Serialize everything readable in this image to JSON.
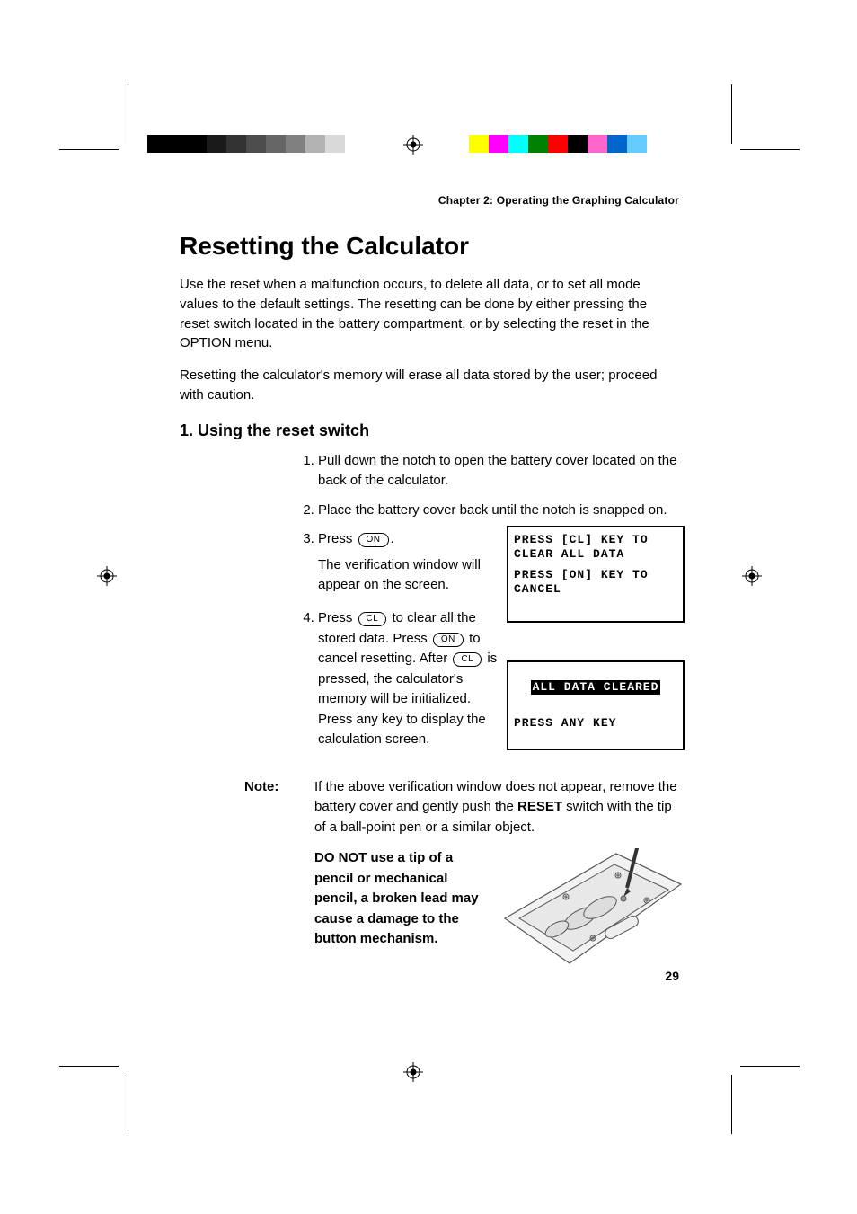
{
  "chapter_header": "Chapter 2: Operating the Graphing Calculator",
  "title": "Resetting the Calculator",
  "intro_p1": "Use the reset when a malfunction occurs, to delete all data, or to set all mode values to the default settings. The resetting can be done by either pressing the reset switch located in the battery compartment, or by selecting the reset in the OPTION menu.",
  "intro_p2": "Resetting the calculator's memory will erase all data stored by the user; proceed with caution.",
  "subsection": "1. Using the reset switch",
  "steps": {
    "s1": "Pull down the notch to open the battery cover located on the back of the calculator.",
    "s2": "Place the battery cover back until the notch is snapped on.",
    "s3a": "Press ",
    "s3_key": "ON",
    "s3b": ".",
    "s3_after": "The verification window will appear on the screen.",
    "s4a": "Press ",
    "s4_key1": "CL",
    "s4b": " to clear all the stored data. Press ",
    "s4_key2": "ON",
    "s4c": " to cancel resetting. After ",
    "s4_key3": "CL",
    "s4d": " is pressed, the calculator's memory will be initialized. Press any key to display the calculation screen."
  },
  "lcd1": {
    "l1": "PRESS [CL] KEY TO",
    "l2": "CLEAR ALL DATA",
    "l3": "PRESS [ON] KEY TO",
    "l4": "CANCEL"
  },
  "lcd2": {
    "banner": " ALL DATA CLEARED ",
    "l2": "PRESS ANY KEY"
  },
  "note": {
    "label": "Note:",
    "p1a": "If the above verification window does not appear, remove the battery cover and gently push the ",
    "p1_bold": "RESET",
    "p1b": " switch with the tip of a ball-point pen or a similar object.",
    "warn": "DO NOT use a tip of a pencil or mechanical pencil, a broken lead may cause a damage to the button mechanism."
  },
  "page_number": "29",
  "colorbars": {
    "left_gray": [
      "#000",
      "#000",
      "#000",
      "#000",
      "#1a1a1a",
      "#333",
      "#4d4d4d",
      "#666",
      "#808080",
      "#b3b3b3"
    ],
    "right_color": [
      "#ffff00",
      "#ff00ff",
      "#00ffff",
      "#008000",
      "#ff0000",
      "#000",
      "#ff66cc",
      "#0066cc",
      "#66ccff"
    ]
  }
}
